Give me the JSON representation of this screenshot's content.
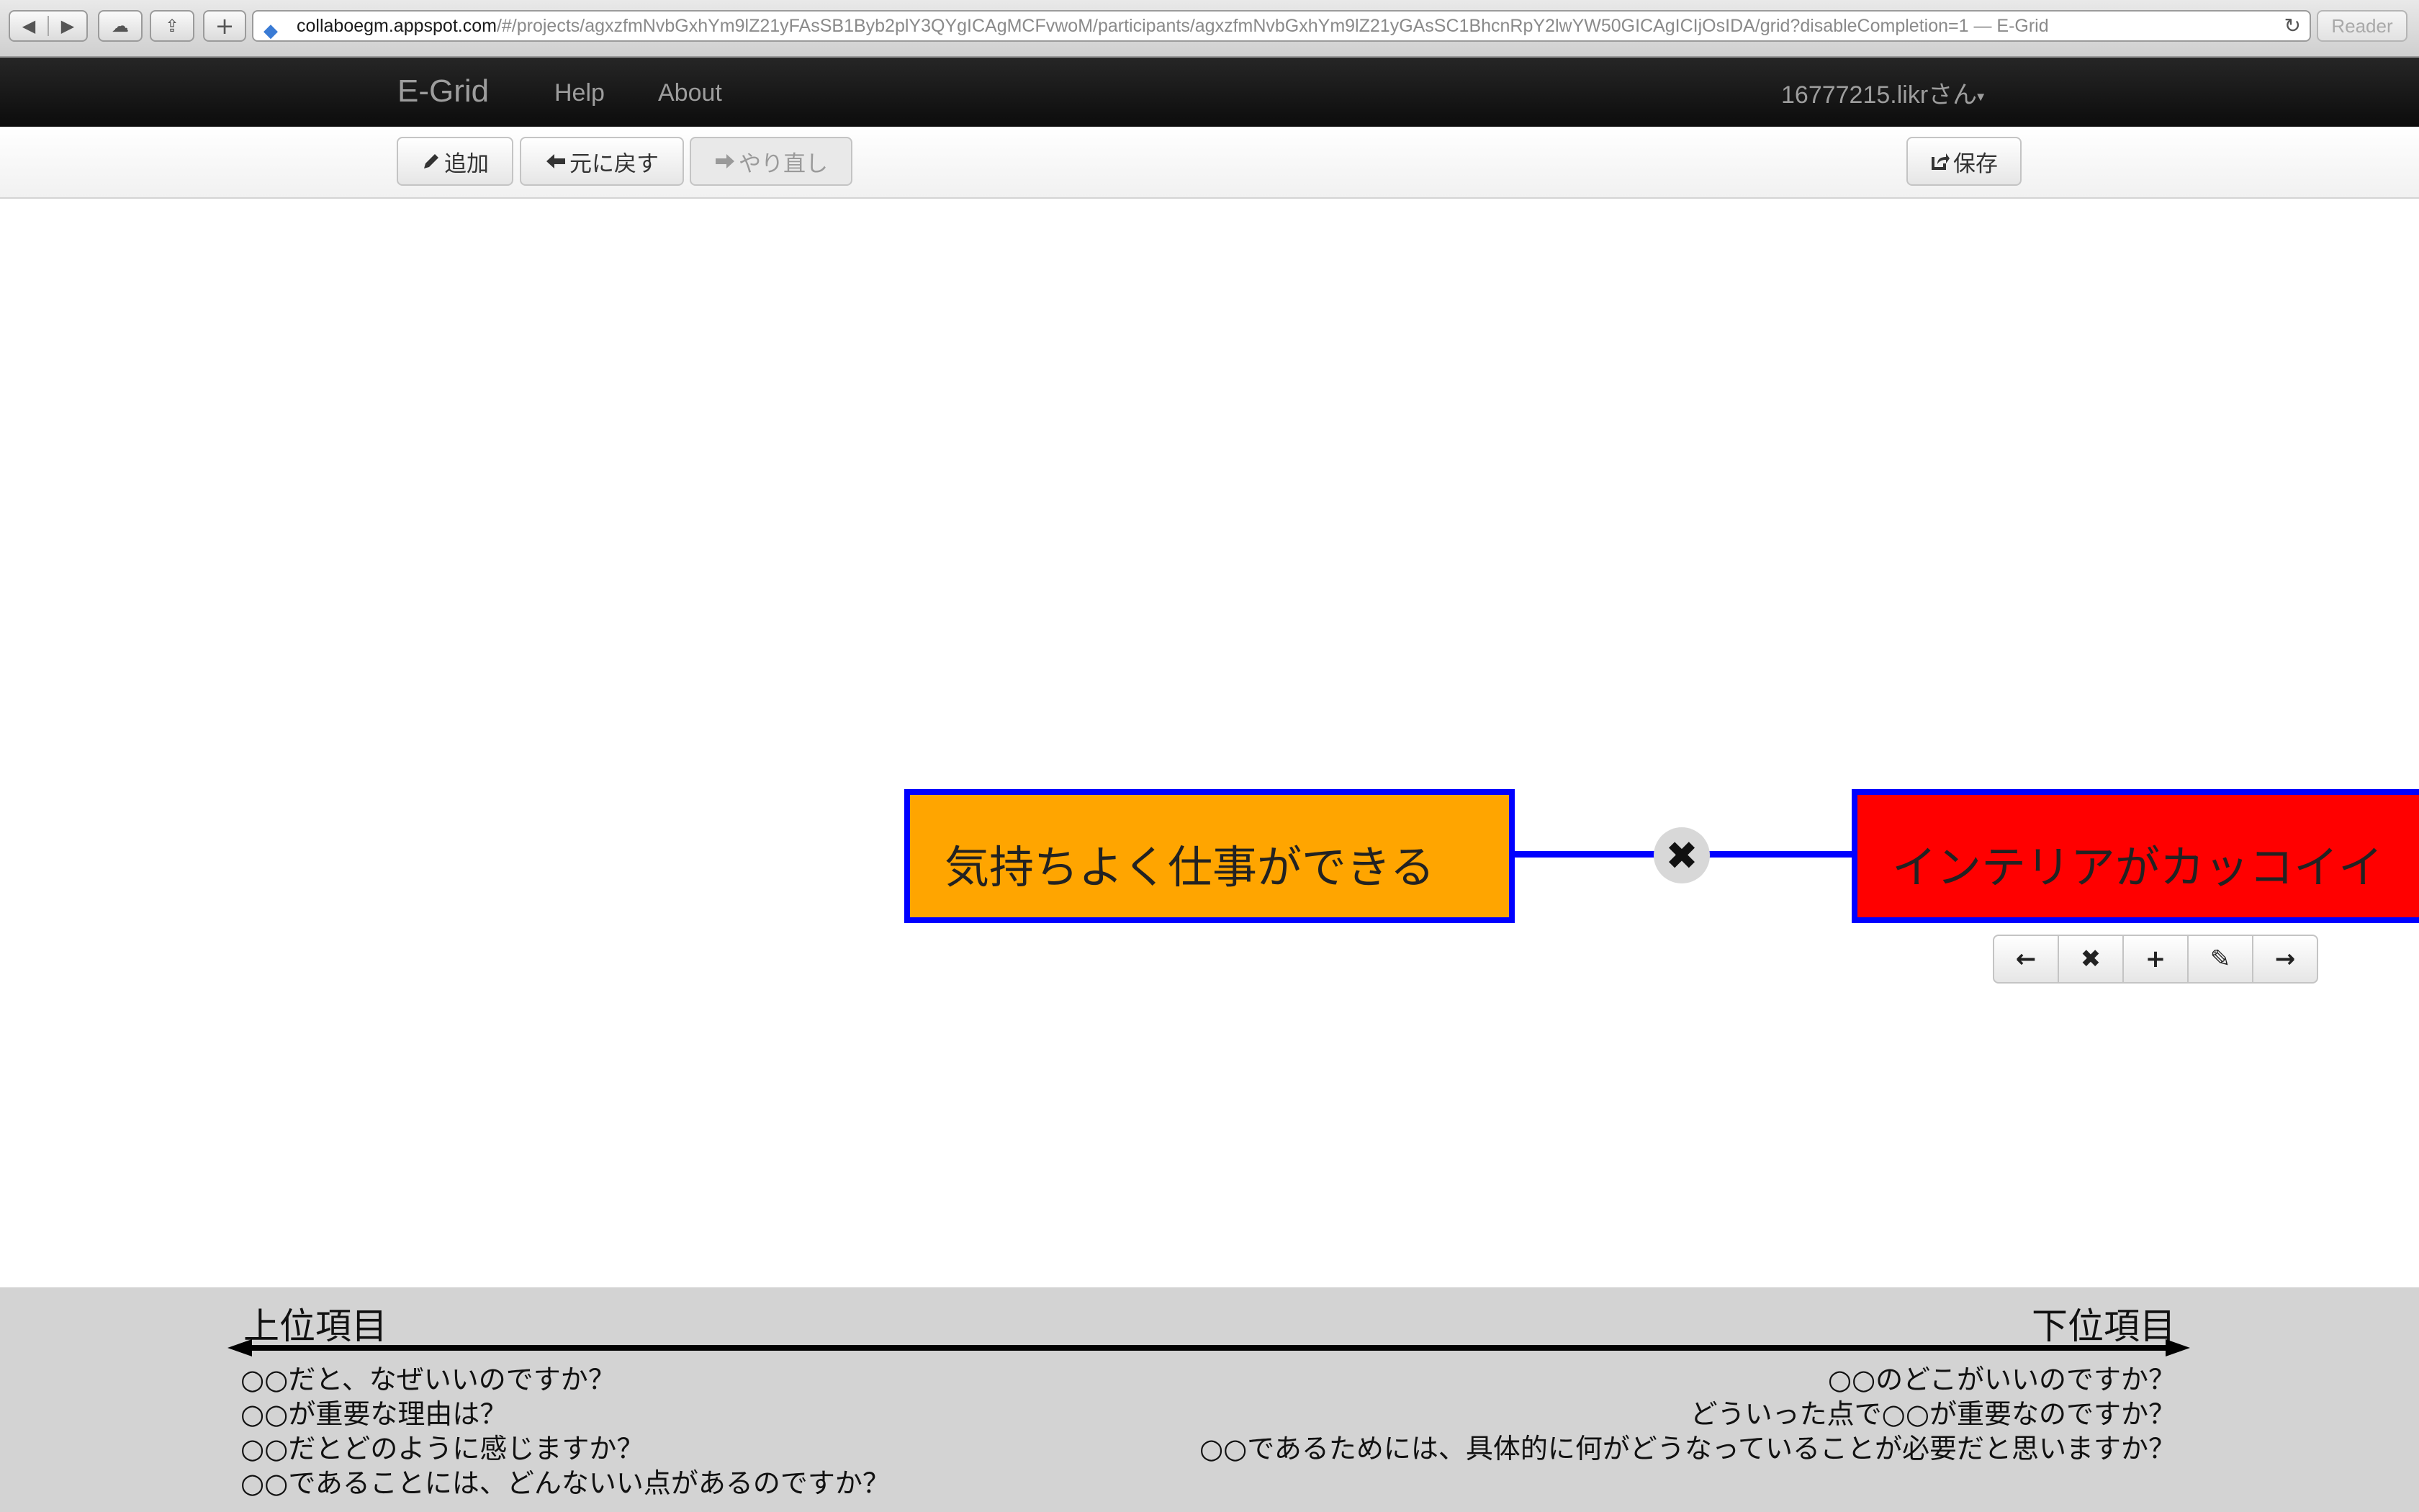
{
  "browser": {
    "back_glyph": "◀",
    "forward_glyph": "▶",
    "cloud_glyph": "☁",
    "share_glyph": "⇪",
    "new_tab_glyph": "+",
    "url_host": "collaboegm.appspot.com",
    "url_rest": "/#/projects/agxzfmNvbGxhYm9lZ21yFAsSB1Byb2plY3QYgICAgMCFvwoM/participants/agxzfmNvbGxhYm9lZ21yGAsSC1BhcnRpY2lwYW50GICAgICIjOsIDA/grid?disableCompletion=1",
    "page_title_suffix": " — E-Grid",
    "reload_glyph": "↻",
    "reader_label": "Reader"
  },
  "navbar": {
    "brand": "E-Grid",
    "help": "Help",
    "about": "About",
    "user": "16777215.likrさん",
    "caret": "▾"
  },
  "toolbar": {
    "add_label": "追加",
    "undo_label": "元に戻す",
    "redo_label": "やり直し",
    "save_label": "保存"
  },
  "grid": {
    "node_left_text": "気持ちよく仕事ができる",
    "node_right_text": "インテリアがカッコイイ",
    "edge_remove_glyph": "✖",
    "tools": [
      "←",
      "✖",
      "+",
      "✎",
      "→"
    ]
  },
  "footer": {
    "upper_label": "上位項目",
    "lower_label": "下位項目",
    "upper_questions": [
      "○○だと、なぜいいのですか？",
      "○○が重要な理由は？",
      "○○だとどのように感じますか？",
      "○○であることには、どんないい点があるのですか？"
    ],
    "lower_questions": [
      "○○のどこがいいのですか？",
      "どういった点で○○が重要なのですか？",
      "○○であるためには、具体的に何がどうなっていることが必要だと思いますか？"
    ]
  },
  "colors": {
    "node_left_fill": "#ffa500",
    "node_right_fill": "#ff0000",
    "node_border": "#0000ff",
    "edge": "#0000ff",
    "footer_bg": "#d3d3d3",
    "navbar_bg": "#111111"
  }
}
